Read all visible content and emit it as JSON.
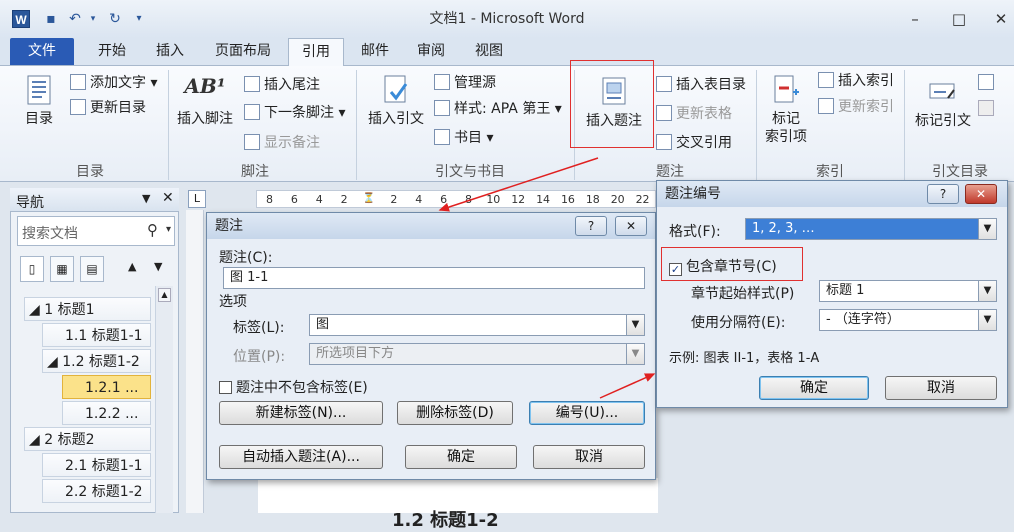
{
  "titlebar": {
    "app_icon": "W",
    "title": "文档1 - Microsoft Word",
    "quick_access": [
      "save-icon",
      "undo-icon",
      "redo-icon"
    ],
    "window_buttons": {
      "minimize": "–",
      "maximize": "□",
      "close": "✕"
    }
  },
  "tabs": [
    "文件",
    "开始",
    "插入",
    "页面布局",
    "引用",
    "邮件",
    "审阅",
    "视图"
  ],
  "active_tab": "引用",
  "ribbon": {
    "toc": {
      "big": "目录",
      "add_text": "添加文字",
      "update": "更新目录",
      "label": "目录"
    },
    "footnote": {
      "big_line1": "插入脚注",
      "insert_endnote": "插入尾注",
      "next_footnote": "下一条脚注",
      "show_notes": "显示备注",
      "label": "脚注",
      "ab_icon": "AB¹"
    },
    "citation": {
      "big": "插入引文",
      "manage": "管理源",
      "style_label": "样式:",
      "style_value": "APA 第王",
      "bibliography": "书目",
      "label": "引文与书目"
    },
    "caption": {
      "big": "插入题注",
      "insert_table_fig": "插入表目录",
      "update_table": "更新表格",
      "cross_ref": "交叉引用",
      "label": "题注"
    },
    "index": {
      "big_line1": "标记",
      "big_line2": "索引项",
      "insert_index": "插入索引",
      "update_index": "更新索引",
      "label": "索引"
    },
    "toa": {
      "big": "标记引文",
      "label": "引文目录"
    }
  },
  "navpane": {
    "title": "导航",
    "search_placeholder": "搜索文档",
    "items": [
      {
        "label": "◢ 1 标题1",
        "level": 1
      },
      {
        "label": "1.1 标题1-1",
        "level": 2
      },
      {
        "label": "◢ 1.2 标题1-2",
        "level": 2
      },
      {
        "label": "1.2.1 ...",
        "level": 3,
        "selected": true
      },
      {
        "label": "1.2.2 ...",
        "level": 3
      },
      {
        "label": "◢ 2 标题2",
        "level": 1
      },
      {
        "label": "2.1 标题1-1",
        "level": 2
      },
      {
        "label": "2.2 标题1-2",
        "level": 2
      }
    ]
  },
  "ruler": {
    "ticks": [
      "8",
      "6",
      "4",
      "2",
      "",
      "2",
      "4",
      "6",
      "8",
      "10",
      "12",
      "14",
      "16",
      "18",
      "20",
      "22"
    ],
    "corner": "L"
  },
  "caption_dialog": {
    "title": "题注",
    "caption_label": "题注(C):",
    "caption_value": "图 1-1",
    "options_label": "选项",
    "label_label": "标签(L):",
    "label_value": "图",
    "position_label": "位置(P):",
    "position_value": "所选项目下方",
    "exclude_label": "题注中不包含标签(E)",
    "new_label": "新建标签(N)...",
    "delete_label": "删除标签(D)",
    "numbering": "编号(U)...",
    "autocaption": "自动插入题注(A)...",
    "ok": "确定",
    "cancel": "取消"
  },
  "numbering_dialog": {
    "title": "题注编号",
    "format_label": "格式(F):",
    "format_value": "1, 2, 3, …",
    "include_chapter": "包含章节号(C)",
    "chapter_style_label": "章节起始样式(P)",
    "chapter_style_value": "标题 1",
    "separator_label": "使用分隔符(E):",
    "separator_value": "-   （连字符）",
    "example_label": "示例:",
    "example_value": "图表 II-1，表格 1-A",
    "ok": "确定",
    "cancel": "取消"
  },
  "doc": {
    "fragment": "1.2 标题1-2"
  },
  "colors": {
    "accent": "#2a5bb5",
    "highlight": "#e03030",
    "selected_item": "#fbe28a"
  }
}
